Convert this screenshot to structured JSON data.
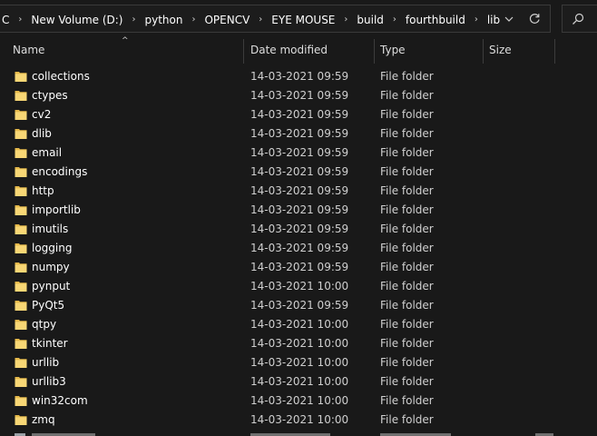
{
  "breadcrumb": {
    "items": [
      "C",
      "New Volume (D:)",
      "python",
      "OPENCV",
      "EYE MOUSE",
      "build",
      "fourthbuild",
      "lib"
    ],
    "separator": "›"
  },
  "columns": {
    "name": "Name",
    "date": "Date modified",
    "type": "Type",
    "size": "Size"
  },
  "sort_indicator": "^",
  "files": [
    {
      "name": "collections",
      "date": "14-03-2021 09:59",
      "type": "File folder",
      "size": ""
    },
    {
      "name": "ctypes",
      "date": "14-03-2021 09:59",
      "type": "File folder",
      "size": ""
    },
    {
      "name": "cv2",
      "date": "14-03-2021 09:59",
      "type": "File folder",
      "size": ""
    },
    {
      "name": "dlib",
      "date": "14-03-2021 09:59",
      "type": "File folder",
      "size": ""
    },
    {
      "name": "email",
      "date": "14-03-2021 09:59",
      "type": "File folder",
      "size": ""
    },
    {
      "name": "encodings",
      "date": "14-03-2021 09:59",
      "type": "File folder",
      "size": ""
    },
    {
      "name": "http",
      "date": "14-03-2021 09:59",
      "type": "File folder",
      "size": ""
    },
    {
      "name": "importlib",
      "date": "14-03-2021 09:59",
      "type": "File folder",
      "size": ""
    },
    {
      "name": "imutils",
      "date": "14-03-2021 09:59",
      "type": "File folder",
      "size": ""
    },
    {
      "name": "logging",
      "date": "14-03-2021 09:59",
      "type": "File folder",
      "size": ""
    },
    {
      "name": "numpy",
      "date": "14-03-2021 09:59",
      "type": "File folder",
      "size": ""
    },
    {
      "name": "pynput",
      "date": "14-03-2021 10:00",
      "type": "File folder",
      "size": ""
    },
    {
      "name": "PyQt5",
      "date": "14-03-2021 09:59",
      "type": "File folder",
      "size": ""
    },
    {
      "name": "qtpy",
      "date": "14-03-2021 10:00",
      "type": "File folder",
      "size": ""
    },
    {
      "name": "tkinter",
      "date": "14-03-2021 10:00",
      "type": "File folder",
      "size": ""
    },
    {
      "name": "urllib",
      "date": "14-03-2021 10:00",
      "type": "File folder",
      "size": ""
    },
    {
      "name": "urllib3",
      "date": "14-03-2021 10:00",
      "type": "File folder",
      "size": ""
    },
    {
      "name": "win32com",
      "date": "14-03-2021 10:00",
      "type": "File folder",
      "size": ""
    },
    {
      "name": "zmq",
      "date": "14-03-2021 10:00",
      "type": "File folder",
      "size": ""
    }
  ],
  "icons": {
    "folder": "folder-icon",
    "dropdown": "chevron-down-icon",
    "refresh": "refresh-icon",
    "search": "search-icon"
  },
  "colors": {
    "background": "#191919",
    "folder": "#f8d775",
    "folder_dark": "#e6b94a",
    "text": "#ffffff",
    "subtext": "#cfcfcf"
  }
}
